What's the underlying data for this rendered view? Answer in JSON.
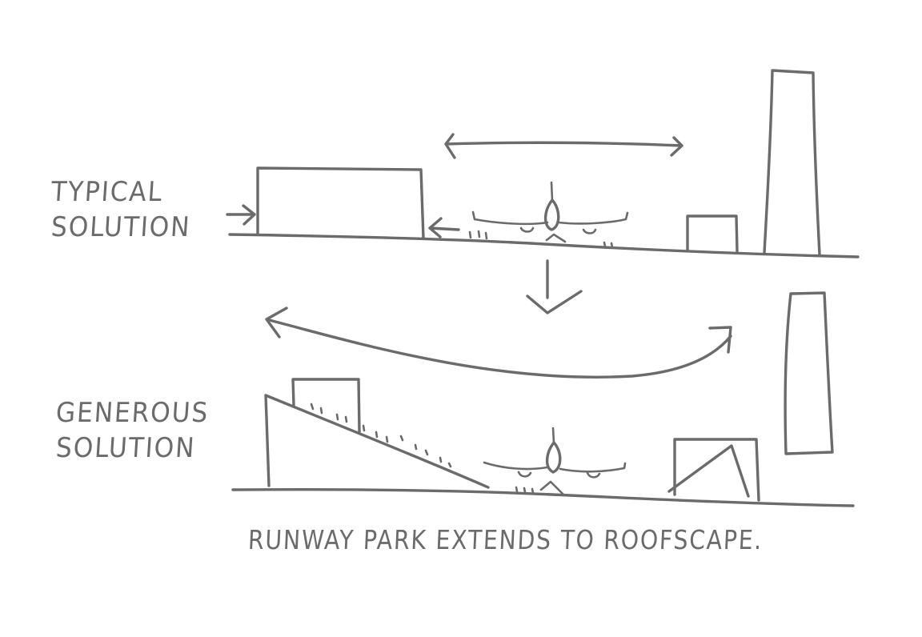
{
  "labels": {
    "typical": [
      "TYPICAL",
      "SOLUTION"
    ],
    "generous": [
      "GENEROUS",
      "SOLUTION"
    ]
  },
  "caption": "RUNWAY PARK EXTENDS TO ROOFSCAPE.",
  "ink_color": "#6b6b6b"
}
